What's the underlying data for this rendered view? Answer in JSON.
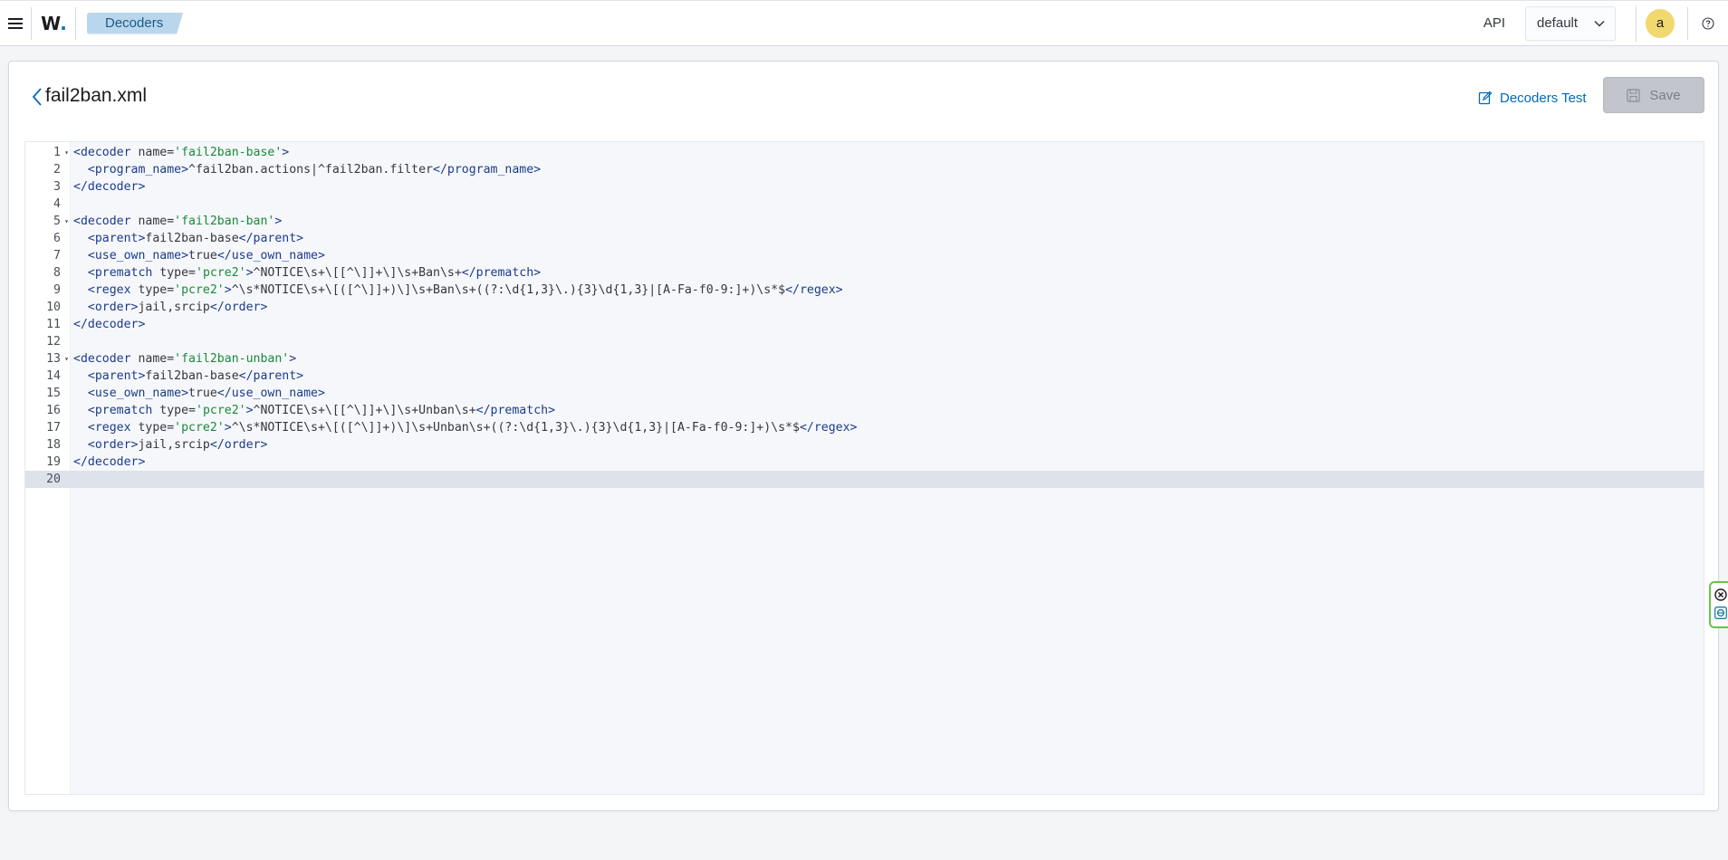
{
  "header": {
    "logo_text": "W",
    "logo_dot": ".",
    "breadcrumb": "Decoders",
    "api_label": "API",
    "api_select_value": "default",
    "user_initial": "a"
  },
  "page": {
    "title": "fail2ban.xml",
    "test_button": "Decoders Test",
    "save_button": "Save"
  },
  "editor": {
    "lines": [
      {
        "n": "1",
        "fold": true,
        "segments": [
          {
            "t": "tag",
            "v": "<decoder"
          },
          {
            "t": "plain",
            "v": " name="
          },
          {
            "t": "str",
            "v": "'fail2ban-base'"
          },
          {
            "t": "tag",
            "v": ">"
          }
        ]
      },
      {
        "n": "2",
        "fold": false,
        "segments": [
          {
            "t": "plain",
            "v": "  "
          },
          {
            "t": "tag",
            "v": "<program_name>"
          },
          {
            "t": "plain",
            "v": "^fail2ban.actions|^fail2ban.filter"
          },
          {
            "t": "tag",
            "v": "</program_name>"
          }
        ]
      },
      {
        "n": "3",
        "fold": false,
        "segments": [
          {
            "t": "tag",
            "v": "</decoder>"
          }
        ]
      },
      {
        "n": "4",
        "fold": false,
        "segments": []
      },
      {
        "n": "5",
        "fold": true,
        "segments": [
          {
            "t": "tag",
            "v": "<decoder"
          },
          {
            "t": "plain",
            "v": " name="
          },
          {
            "t": "str",
            "v": "'fail2ban-ban'"
          },
          {
            "t": "tag",
            "v": ">"
          }
        ]
      },
      {
        "n": "6",
        "fold": false,
        "segments": [
          {
            "t": "plain",
            "v": "  "
          },
          {
            "t": "tag",
            "v": "<parent>"
          },
          {
            "t": "plain",
            "v": "fail2ban-base"
          },
          {
            "t": "tag",
            "v": "</parent>"
          }
        ]
      },
      {
        "n": "7",
        "fold": false,
        "segments": [
          {
            "t": "plain",
            "v": "  "
          },
          {
            "t": "tag",
            "v": "<use_own_name>"
          },
          {
            "t": "plain",
            "v": "true"
          },
          {
            "t": "tag",
            "v": "</use_own_name>"
          }
        ]
      },
      {
        "n": "8",
        "fold": false,
        "segments": [
          {
            "t": "plain",
            "v": "  "
          },
          {
            "t": "tag",
            "v": "<prematch"
          },
          {
            "t": "plain",
            "v": " type="
          },
          {
            "t": "str",
            "v": "'pcre2'"
          },
          {
            "t": "tag",
            "v": ">"
          },
          {
            "t": "plain",
            "v": "^NOTICE\\s+\\[[^\\]]+\\]\\s+Ban\\s+"
          },
          {
            "t": "tag",
            "v": "</prematch>"
          }
        ]
      },
      {
        "n": "9",
        "fold": false,
        "segments": [
          {
            "t": "plain",
            "v": "  "
          },
          {
            "t": "tag",
            "v": "<regex"
          },
          {
            "t": "plain",
            "v": " type="
          },
          {
            "t": "str",
            "v": "'pcre2'"
          },
          {
            "t": "tag",
            "v": ">"
          },
          {
            "t": "plain",
            "v": "^\\s*NOTICE\\s+\\[([^\\]]+)\\]\\s+Ban\\s+((?:\\d{1,3}\\.){3}\\d{1,3}|[A-Fa-f0-9:]+)\\s*$"
          },
          {
            "t": "tag",
            "v": "</regex>"
          }
        ]
      },
      {
        "n": "10",
        "fold": false,
        "segments": [
          {
            "t": "plain",
            "v": "  "
          },
          {
            "t": "tag",
            "v": "<order>"
          },
          {
            "t": "plain",
            "v": "jail,srcip"
          },
          {
            "t": "tag",
            "v": "</order>"
          }
        ]
      },
      {
        "n": "11",
        "fold": false,
        "segments": [
          {
            "t": "tag",
            "v": "</decoder>"
          }
        ]
      },
      {
        "n": "12",
        "fold": false,
        "segments": []
      },
      {
        "n": "13",
        "fold": true,
        "segments": [
          {
            "t": "tag",
            "v": "<decoder"
          },
          {
            "t": "plain",
            "v": " name="
          },
          {
            "t": "str",
            "v": "'fail2ban-unban'"
          },
          {
            "t": "tag",
            "v": ">"
          }
        ]
      },
      {
        "n": "14",
        "fold": false,
        "segments": [
          {
            "t": "plain",
            "v": "  "
          },
          {
            "t": "tag",
            "v": "<parent>"
          },
          {
            "t": "plain",
            "v": "fail2ban-base"
          },
          {
            "t": "tag",
            "v": "</parent>"
          }
        ]
      },
      {
        "n": "15",
        "fold": false,
        "segments": [
          {
            "t": "plain",
            "v": "  "
          },
          {
            "t": "tag",
            "v": "<use_own_name>"
          },
          {
            "t": "plain",
            "v": "true"
          },
          {
            "t": "tag",
            "v": "</use_own_name>"
          }
        ]
      },
      {
        "n": "16",
        "fold": false,
        "segments": [
          {
            "t": "plain",
            "v": "  "
          },
          {
            "t": "tag",
            "v": "<prematch"
          },
          {
            "t": "plain",
            "v": " type="
          },
          {
            "t": "str",
            "v": "'pcre2'"
          },
          {
            "t": "tag",
            "v": ">"
          },
          {
            "t": "plain",
            "v": "^NOTICE\\s+\\[[^\\]]+\\]\\s+Unban\\s+"
          },
          {
            "t": "tag",
            "v": "</prematch>"
          }
        ]
      },
      {
        "n": "17",
        "fold": false,
        "segments": [
          {
            "t": "plain",
            "v": "  "
          },
          {
            "t": "tag",
            "v": "<regex"
          },
          {
            "t": "plain",
            "v": " type="
          },
          {
            "t": "str",
            "v": "'pcre2'"
          },
          {
            "t": "tag",
            "v": ">"
          },
          {
            "t": "plain",
            "v": "^\\s*NOTICE\\s+\\[([^\\]]+)\\]\\s+Unban\\s+((?:\\d{1,3}\\.){3}\\d{1,3}|[A-Fa-f0-9:]+)\\s*$"
          },
          {
            "t": "tag",
            "v": "</regex>"
          }
        ]
      },
      {
        "n": "18",
        "fold": false,
        "segments": [
          {
            "t": "plain",
            "v": "  "
          },
          {
            "t": "tag",
            "v": "<order>"
          },
          {
            "t": "plain",
            "v": "jail,srcip"
          },
          {
            "t": "tag",
            "v": "</order>"
          }
        ]
      },
      {
        "n": "19",
        "fold": false,
        "segments": [
          {
            "t": "tag",
            "v": "</decoder>"
          }
        ]
      },
      {
        "n": "20",
        "fold": false,
        "active": true,
        "segments": []
      }
    ]
  },
  "icons": {
    "menu": "hamburger-menu-icon",
    "chevron": "chevron-down-icon",
    "help": "help-icon",
    "back": "arrow-left-icon",
    "test": "pencil-square-icon",
    "save": "floppy-disk-icon",
    "fold": "fold-caret-icon",
    "widget_close": "close-circle-icon",
    "widget_logo": "extension-logo-icon"
  },
  "colors": {
    "accent": "#006bb8",
    "breadcrumb_bg": "#bad6ec",
    "tag": "#1d3b8b",
    "string": "#1b8a3a",
    "avatar": "#f1d86f"
  }
}
